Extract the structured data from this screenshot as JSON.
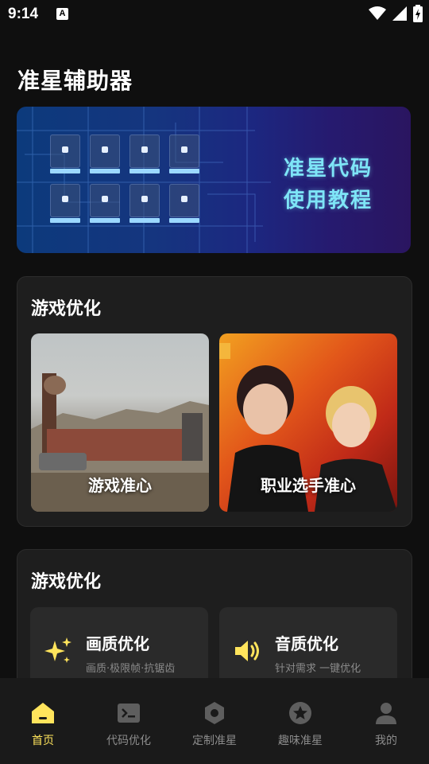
{
  "status_bar": {
    "time": "9:14",
    "notification_icon": "A"
  },
  "app": {
    "title": "准星辅助器"
  },
  "banner": {
    "line1": "准星代码",
    "line2": "使用教程"
  },
  "section_aim": {
    "title": "游戏优化",
    "cards": [
      {
        "label": "游戏准心"
      },
      {
        "label": "职业选手准心"
      }
    ]
  },
  "section_opt": {
    "title": "游戏优化",
    "items": [
      {
        "title": "画质优化",
        "subtitle": "画质·极限帧·抗锯齿",
        "icon": "sparkle-icon"
      },
      {
        "title": "音质优化",
        "subtitle": "针对需求 一键优化",
        "icon": "speaker-icon"
      }
    ]
  },
  "bottom_nav": {
    "items": [
      {
        "label": "首页",
        "icon": "home-icon",
        "active": true
      },
      {
        "label": "代码优化",
        "icon": "terminal-icon",
        "active": false
      },
      {
        "label": "定制准星",
        "icon": "hexagon-icon",
        "active": false
      },
      {
        "label": "趣味准星",
        "icon": "star-icon",
        "active": false
      },
      {
        "label": "我的",
        "icon": "user-icon",
        "active": false
      }
    ]
  },
  "colors": {
    "accent": "#ffe45c",
    "background": "#0f0f0f",
    "card": "#1e1e1e",
    "banner_text": "#7ee5f7"
  }
}
